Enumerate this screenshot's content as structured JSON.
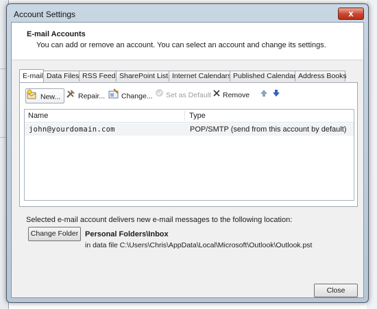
{
  "window": {
    "title": "Account Settings",
    "close_glyph": "x"
  },
  "header": {
    "title": "E-mail Accounts",
    "description": "You can add or remove an account. You can select an account and change its settings."
  },
  "tabs": [
    {
      "label": "E-mail",
      "active": true
    },
    {
      "label": "Data Files",
      "active": false
    },
    {
      "label": "RSS Feeds",
      "active": false
    },
    {
      "label": "SharePoint Lists",
      "active": false
    },
    {
      "label": "Internet Calendars",
      "active": false
    },
    {
      "label": "Published Calendars",
      "active": false
    },
    {
      "label": "Address Books",
      "active": false
    }
  ],
  "toolbar": {
    "new_label": "New...",
    "repair_label": "Repair...",
    "change_label": "Change...",
    "set_default_label": "Set as Default",
    "remove_label": "Remove",
    "icons": [
      "new-account-icon",
      "repair-icon",
      "change-icon",
      "check-icon",
      "remove-x-icon",
      "move-up-arrow-icon",
      "move-down-arrow-icon"
    ]
  },
  "accounts_table": {
    "columns": [
      "Name",
      "Type"
    ],
    "rows": [
      {
        "name": "john@yourdomain.com",
        "type": "POP/SMTP (send from this account by default)"
      }
    ]
  },
  "delivery": {
    "note": "Selected e-mail account delivers new e-mail messages to the following location:",
    "change_folder_label": "Change Folder",
    "folder_path": "Personal Folders\\Inbox",
    "data_file": "in data file C:\\Users\\Chris\\AppData\\Local\\Microsoft\\Outlook\\Outlook.pst"
  },
  "footer": {
    "close_label": "Close"
  },
  "colors": {
    "frame": "#b8c7d6",
    "close_button": "#c7452f",
    "arrow_up": "#8aa4bf",
    "arrow_down": "#2f62c2"
  }
}
